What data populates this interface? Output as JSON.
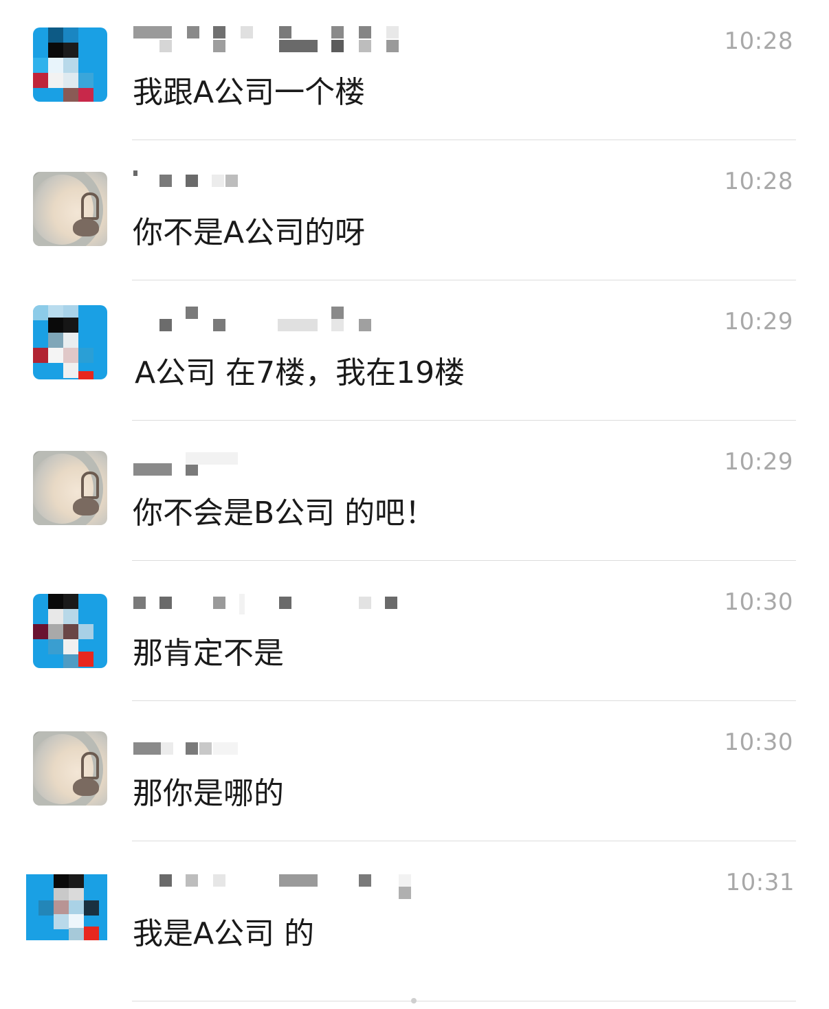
{
  "chats": [
    {
      "time": "10:28",
      "message": "我跟A公司一个楼",
      "avatar": "mosaic"
    },
    {
      "time": "10:28",
      "message": "你不是A公司的呀",
      "avatar": "photo"
    },
    {
      "time": "10:29",
      "message": "A公司 在7楼，我在19楼",
      "avatar": "mosaic"
    },
    {
      "time": "10:29",
      "message": "你不会是B公司 的吧！",
      "avatar": "photo"
    },
    {
      "time": "10:30",
      "message": "那肯定不是",
      "avatar": "mosaic"
    },
    {
      "time": "10:30",
      "message": "那你是哪的",
      "avatar": "photo"
    },
    {
      "time": "10:31",
      "message": "我是A公司 的",
      "avatar": "mosaic"
    }
  ],
  "colors": {
    "time": "#a8a8a8",
    "message": "#1a1a1a",
    "divider": "#dcdcdc",
    "avatar_blue": "#1aa0e4"
  }
}
